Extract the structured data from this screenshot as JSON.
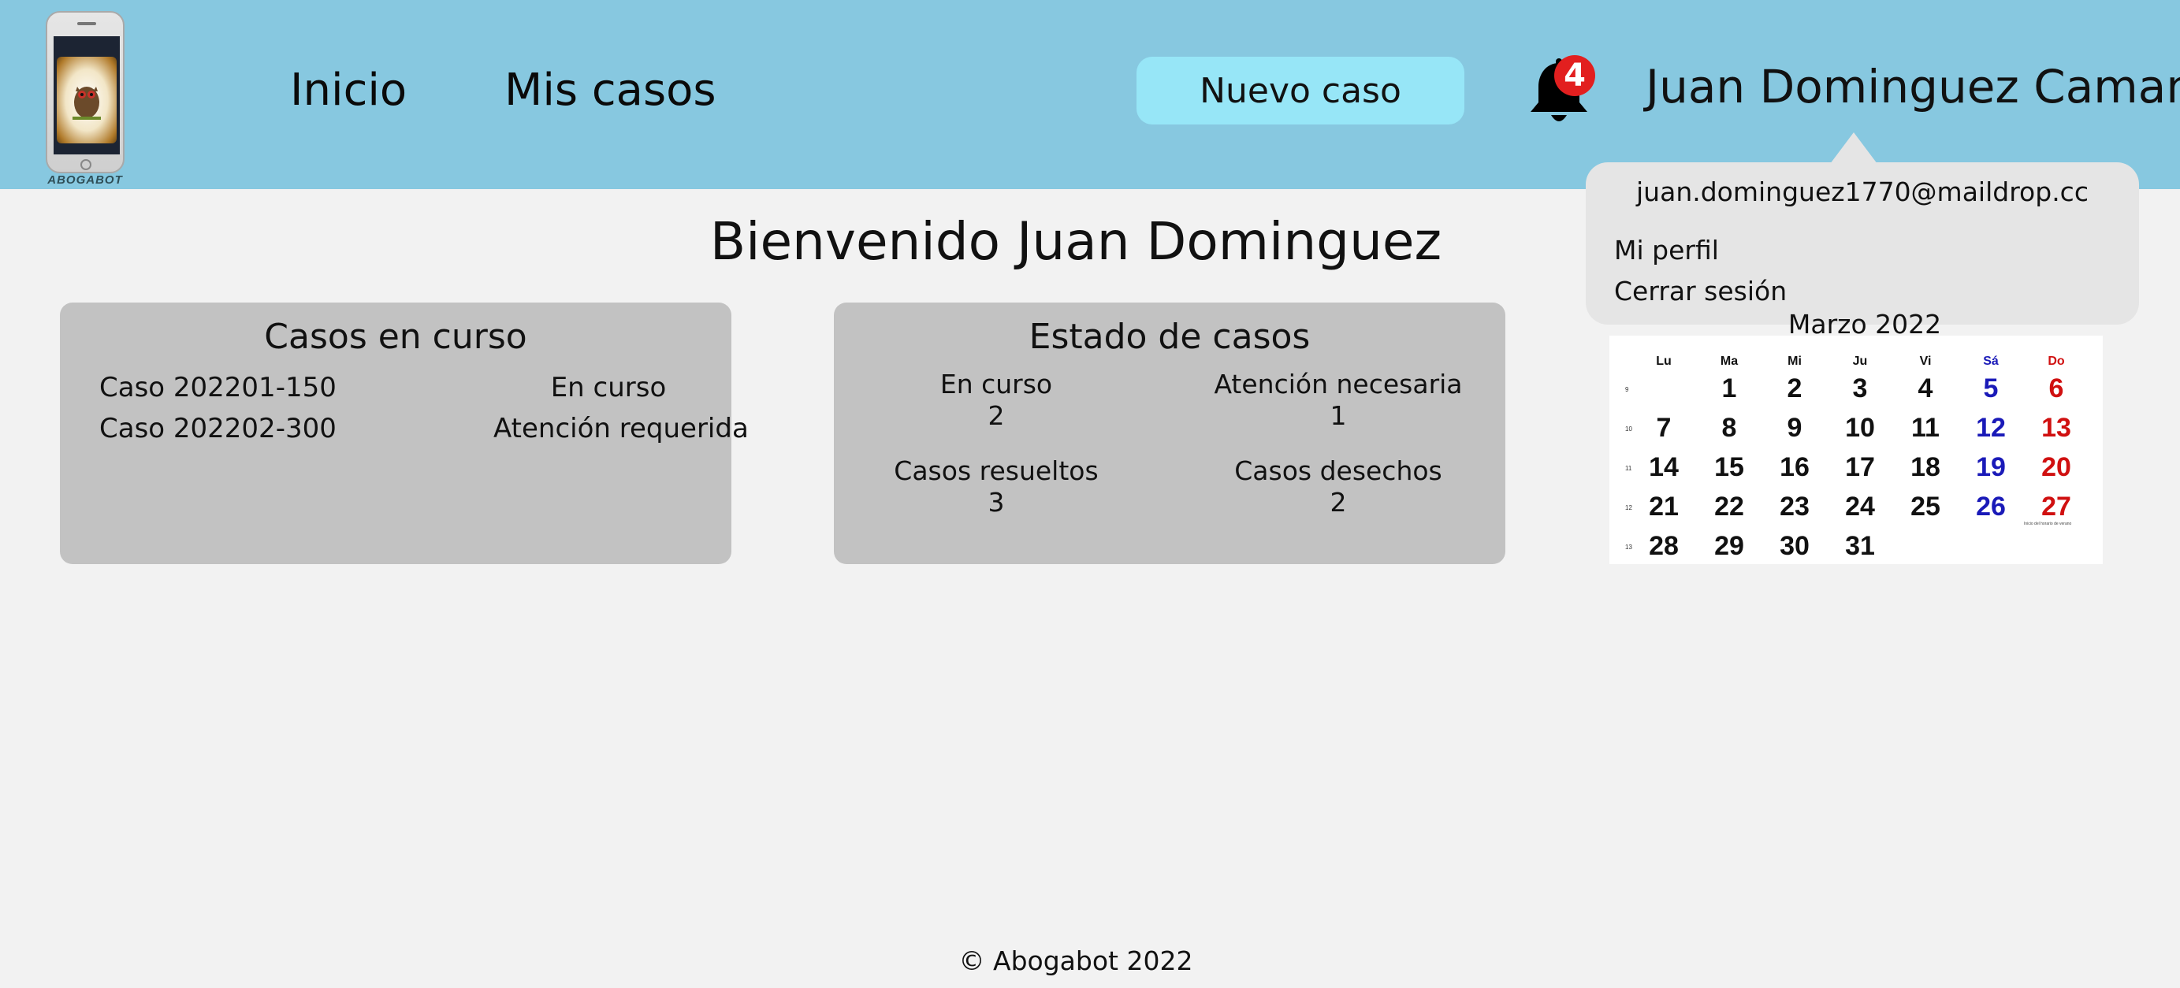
{
  "header": {
    "logo_text": "ABOGABOT",
    "nav": [
      {
        "label": "Inicio"
      },
      {
        "label": "Mis casos"
      }
    ],
    "new_case_label": "Nuevo caso",
    "notifications_count": "4",
    "user_name": "Juan Dominguez Camaney"
  },
  "user_menu": {
    "email": "juan.dominguez1770@maildrop.cc",
    "items": [
      {
        "label": "Mi perfil"
      },
      {
        "label": "Cerrar sesión"
      }
    ]
  },
  "main": {
    "welcome": "Bienvenido Juan Dominguez",
    "cases_in_progress": {
      "title": "Casos en curso",
      "rows": [
        {
          "id": "Caso 202201-150",
          "status": "En curso"
        },
        {
          "id": "Caso 202202-300",
          "status": "Atención requerida"
        }
      ]
    },
    "case_status": {
      "title": "Estado de casos",
      "stats": [
        {
          "label": "En curso",
          "value": "2"
        },
        {
          "label": "Atención necesaria",
          "value": "1"
        },
        {
          "label": "Casos resueltos",
          "value": "3"
        },
        {
          "label": "Casos desechos",
          "value": "2"
        }
      ]
    }
  },
  "calendar": {
    "title": "Marzo 2022",
    "weekday_headers": [
      "Lu",
      "Ma",
      "Mi",
      "Ju",
      "Vi",
      "Sá",
      "Do"
    ],
    "weeks": [
      {
        "number": "9",
        "days": [
          "",
          "1",
          "2",
          "3",
          "4",
          "5",
          "6"
        ]
      },
      {
        "number": "10",
        "days": [
          "7",
          "8",
          "9",
          "10",
          "11",
          "12",
          "13"
        ]
      },
      {
        "number": "11",
        "days": [
          "14",
          "15",
          "16",
          "17",
          "18",
          "19",
          "20"
        ]
      },
      {
        "number": "12",
        "days": [
          "21",
          "22",
          "23",
          "24",
          "25",
          "26",
          "27"
        ]
      },
      {
        "number": "13",
        "days": [
          "28",
          "29",
          "30",
          "31",
          "",
          "",
          ""
        ]
      }
    ],
    "note": "Inicio del horario de verano",
    "colors": {
      "saturday": "#1a1ab8",
      "sunday": "#d01010"
    }
  },
  "footer": {
    "copyright": "© Abogabot 2022"
  }
}
